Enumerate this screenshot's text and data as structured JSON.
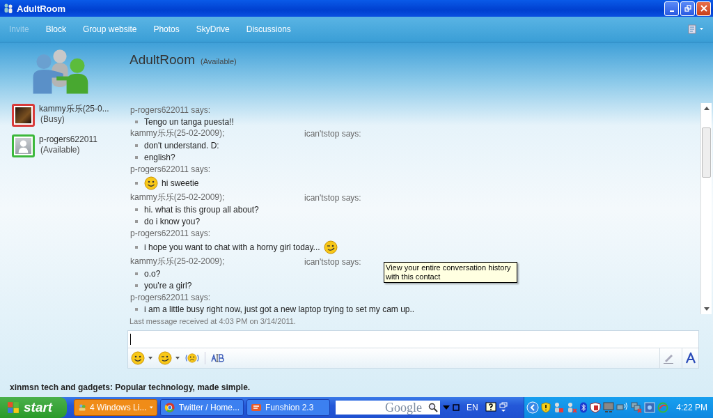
{
  "window": {
    "title": "AdultRoom"
  },
  "toolbar": [
    {
      "label": "Invite",
      "disabled": true
    },
    {
      "label": "Block",
      "disabled": false
    },
    {
      "label": "Group website",
      "disabled": false
    },
    {
      "label": "Photos",
      "disabled": false
    },
    {
      "label": "SkyDrive",
      "disabled": false
    },
    {
      "label": "Discussions",
      "disabled": false
    }
  ],
  "header": {
    "name": "AdultRoom",
    "status": "(Available)"
  },
  "contacts": [
    {
      "name": "kammy乐乐(25-0...",
      "status": "(Busy)",
      "color": "#d83a3a",
      "kind": "photo"
    },
    {
      "name": "p-rogers622011",
      "status": "(Available)",
      "color": "#3cb83c",
      "kind": "silhouette"
    }
  ],
  "messages": [
    {
      "sender": [
        "p-rogers622011 says:"
      ],
      "lines": [
        {
          "text": "Tengo un tanga puesta!!"
        }
      ]
    },
    {
      "sender": [
        "kammy乐乐(25-02-2009);",
        "ican'tstop says:"
      ],
      "lines": [
        {
          "text": "don't understand. D:"
        },
        {
          "text": "english?"
        }
      ]
    },
    {
      "sender": [
        "p-rogers622011 says:"
      ],
      "lines": [
        {
          "text": "hi sweetie",
          "kind": "smile_before"
        }
      ]
    },
    {
      "sender": [
        "kammy乐乐(25-02-2009);",
        "ican'tstop says:"
      ],
      "lines": [
        {
          "text": "hi. what is this group all about?"
        },
        {
          "text": "do i know you?"
        }
      ]
    },
    {
      "sender": [
        "p-rogers622011 says:"
      ],
      "lines": [
        {
          "text": "i hope you want to chat with a horny girl today...",
          "kind": "wink_after"
        }
      ]
    },
    {
      "sender": [
        "kammy乐乐(25-02-2009);",
        "ican'tstop says:"
      ],
      "lines": [
        {
          "text": "o.o?"
        },
        {
          "text": "you're a girl?"
        }
      ]
    },
    {
      "sender": [
        "p-rogers622011 says:"
      ],
      "lines": [
        {
          "text": "i am a little busy right now, just got a new laptop trying to set my cam up.."
        }
      ]
    }
  ],
  "tooltip": "View your entire conversation history with this contact",
  "last_message": "Last message received at 4:03 PM on 3/14/2011.",
  "ad": "xinmsn tech and gadgets: Popular technology, made simple.",
  "taskbar": {
    "start": "start",
    "tasks": [
      {
        "label": "4 Windows Li...",
        "selected": true,
        "kind": "messenger"
      },
      {
        "label": "Twitter / Home...",
        "selected": false,
        "kind": "browser"
      },
      {
        "label": "Funshion 2.3",
        "selected": false,
        "kind": "player"
      }
    ],
    "search": {
      "placeholder": "Google"
    },
    "language": "EN",
    "clock": "4:22 PM"
  }
}
